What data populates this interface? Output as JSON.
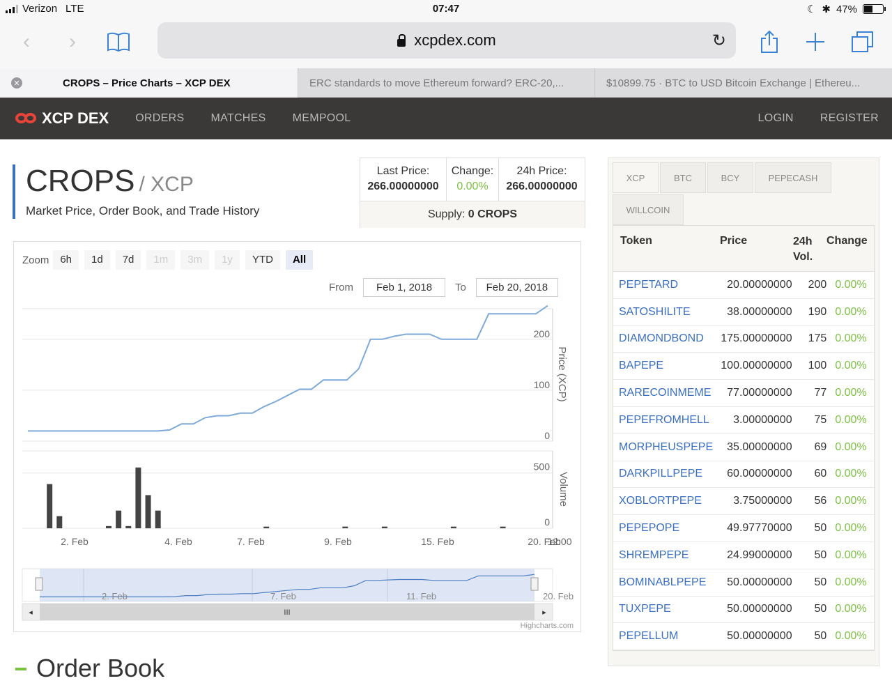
{
  "status": {
    "carrier": "Verizon",
    "network": "LTE",
    "time": "07:47",
    "battery": "47%",
    "battery_level": 0.47
  },
  "browser": {
    "url": "xcpdex.com",
    "tabs": [
      {
        "title": "CROPS – Price Charts – XCP DEX"
      },
      {
        "title": "ERC standards to move Ethereum forward? ERC-20,..."
      },
      {
        "title": "$10899.75 · BTC to USD Bitcoin Exchange | Ethereu..."
      }
    ]
  },
  "site": {
    "brand": "XCP DEX",
    "nav": [
      "ORDERS",
      "MATCHES",
      "MEMPOOL"
    ],
    "nav_right": [
      "LOGIN",
      "REGISTER"
    ],
    "accent": "#3b6fc2",
    "positive_color": "#7dc143"
  },
  "asset": {
    "name": "CROPS",
    "quote": "/ XCP",
    "subtitle": "Market Price, Order Book, and Trade History",
    "last_price_label": "Last Price:",
    "last_price": "266.00000000",
    "change_label": "Change:",
    "change": "0.00%",
    "price24_label": "24h Price:",
    "price24": "266.00000000",
    "supply_label": "Supply:",
    "supply": "0 CROPS"
  },
  "chart_controls": {
    "zoom_label": "Zoom",
    "zoom_buttons": [
      "6h",
      "1d",
      "7d",
      "1m",
      "3m",
      "1y",
      "YTD",
      "All"
    ],
    "from_label": "From",
    "from_value": "Feb 1, 2018",
    "to_label": "To",
    "to_value": "Feb 20, 2018",
    "credit": "Highcharts.com"
  },
  "chart_data": {
    "type": "line",
    "price_axis_label": "Price (XCP)",
    "volume_axis_label": "Volume",
    "price_ticks": [
      0,
      100,
      200
    ],
    "volume_ticks": [
      0,
      500
    ],
    "x_ticks": [
      "2. Feb",
      "4. Feb",
      "7. Feb",
      "9. Feb",
      "15. Feb",
      "20. Feb",
      "12:00"
    ],
    "navigator_ticks": [
      "2. Feb",
      "7. Feb",
      "11. Feb",
      "20. Feb"
    ],
    "price_series": [
      20,
      20,
      20,
      20,
      20,
      20,
      20,
      20,
      20,
      20,
      20,
      20,
      22,
      34,
      34,
      46,
      50,
      50,
      55,
      55,
      68,
      78,
      90,
      102,
      102,
      120,
      120,
      120,
      142,
      200,
      200,
      206,
      210,
      210,
      210,
      200,
      200,
      200,
      200,
      250,
      250,
      250,
      250,
      250,
      266
    ],
    "volume_series": [
      0,
      400,
      110,
      0,
      0,
      0,
      0,
      20,
      160,
      20,
      550,
      300,
      160,
      0,
      0,
      0,
      0,
      0,
      0,
      0,
      0,
      0,
      0,
      15,
      0,
      0,
      0,
      0,
      0,
      0,
      0,
      15,
      0,
      0,
      0,
      15,
      0,
      0,
      0,
      0,
      0,
      0,
      15,
      0,
      0,
      0,
      0,
      15,
      0,
      0,
      0
    ]
  },
  "token_panel": {
    "currency_tabs": [
      "XCP",
      "BTC",
      "BCY",
      "PEPECASH",
      "WILLCOIN"
    ],
    "headers": {
      "token": "Token",
      "price": "Price",
      "vol": "24h Vol.",
      "change": "Change"
    },
    "rows": [
      {
        "token": "PEPETARD",
        "price": "20.00000000",
        "vol": "200",
        "change": "0.00%"
      },
      {
        "token": "SATOSHILITE",
        "price": "38.00000000",
        "vol": "190",
        "change": "0.00%"
      },
      {
        "token": "DIAMONDBOND",
        "price": "175.00000000",
        "vol": "175",
        "change": "0.00%"
      },
      {
        "token": "BAPEPE",
        "price": "100.00000000",
        "vol": "100",
        "change": "0.00%"
      },
      {
        "token": "RARECOINMEME",
        "price": "77.00000000",
        "vol": "77",
        "change": "0.00%"
      },
      {
        "token": "PEPEFROMHELL",
        "price": "3.00000000",
        "vol": "75",
        "change": "0.00%"
      },
      {
        "token": "MORPHEUSPEPE",
        "price": "35.00000000",
        "vol": "69",
        "change": "0.00%"
      },
      {
        "token": "DARKPILLPEPE",
        "price": "60.00000000",
        "vol": "60",
        "change": "0.00%"
      },
      {
        "token": "XOBLORTPEPE",
        "price": "3.75000000",
        "vol": "56",
        "change": "0.00%"
      },
      {
        "token": "PEPEPOPE",
        "price": "49.97770000",
        "vol": "50",
        "change": "0.00%"
      },
      {
        "token": "SHREMPEPE",
        "price": "24.99000000",
        "vol": "50",
        "change": "0.00%"
      },
      {
        "token": "BOMINABLPEPE",
        "price": "50.00000000",
        "vol": "50",
        "change": "0.00%"
      },
      {
        "token": "TUXPEPE",
        "price": "50.00000000",
        "vol": "50",
        "change": "0.00%"
      },
      {
        "token": "PEPELLUM",
        "price": "50.00000000",
        "vol": "50",
        "change": "0.00%"
      }
    ]
  },
  "orderbook_title": "Order Book"
}
